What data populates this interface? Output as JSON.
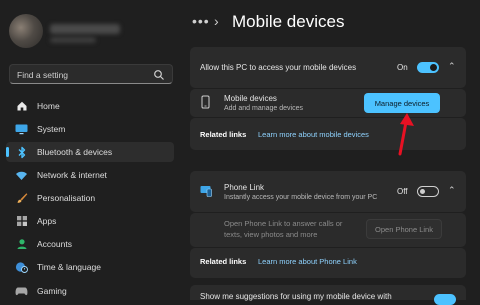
{
  "sidebar": {
    "search_placeholder": "Find a setting",
    "items": [
      {
        "label": "Home",
        "icon": "home-icon"
      },
      {
        "label": "System",
        "icon": "monitor-icon"
      },
      {
        "label": "Bluetooth & devices",
        "icon": "bluetooth-icon",
        "selected": true
      },
      {
        "label": "Network & internet",
        "icon": "wifi-icon"
      },
      {
        "label": "Personalisation",
        "icon": "brush-icon"
      },
      {
        "label": "Apps",
        "icon": "apps-icon"
      },
      {
        "label": "Accounts",
        "icon": "person-icon"
      },
      {
        "label": "Time & language",
        "icon": "globe-clock-icon"
      },
      {
        "label": "Gaming",
        "icon": "gamepad-icon"
      }
    ]
  },
  "header": {
    "breadcrumb_more": "•••",
    "title": "Mobile devices"
  },
  "mobile_access": {
    "label": "Allow this PC to access your mobile devices",
    "toggle_state": "On",
    "toggle_on": true,
    "device_title": "Mobile devices",
    "device_subtitle": "Add and manage devices",
    "manage_button": "Manage devices",
    "related_links_label": "Related links",
    "related_link": "Learn more about mobile devices"
  },
  "phone_link": {
    "title": "Phone Link",
    "subtitle": "Instantly access your mobile device from your PC",
    "toggle_state": "Off",
    "toggle_on": false,
    "open_text_line1": "Open Phone Link to answer calls or",
    "open_text_line2": "texts, view photos and more",
    "open_button": "Open Phone Link",
    "related_links_label": "Related links",
    "related_link": "Learn more about Phone Link"
  },
  "suggestions": {
    "label": "Show me suggestions for using my mobile device with"
  },
  "colors": {
    "accent": "#4cc2ff",
    "background": "#1f1f1f",
    "card": "#2b2b2b",
    "arrow": "#e81123"
  }
}
